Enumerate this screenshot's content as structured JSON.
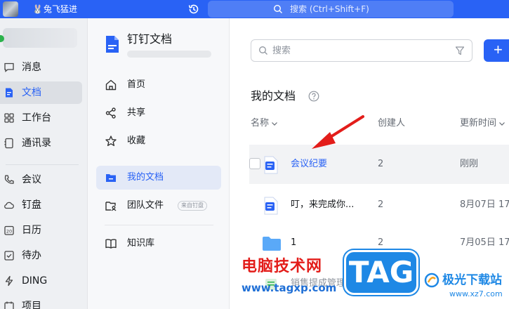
{
  "topbar": {
    "user_emoji": "🐰",
    "user_name": "兔飞猛进",
    "search_placeholder": "搜索 (Ctrl+Shift+F)"
  },
  "leftnav": {
    "items": [
      {
        "label": "消息",
        "icon": "message-icon"
      },
      {
        "label": "文档",
        "icon": "doc-icon",
        "active": true
      },
      {
        "label": "工作台",
        "icon": "grid-icon"
      },
      {
        "label": "通讯录",
        "icon": "contacts-icon"
      },
      {
        "label": "会议",
        "icon": "phone-icon"
      },
      {
        "label": "钉盘",
        "icon": "cloud-icon"
      },
      {
        "label": "日历",
        "icon": "calendar-icon"
      },
      {
        "label": "待办",
        "icon": "todo-icon"
      },
      {
        "label": "DING",
        "icon": "lightning-icon"
      },
      {
        "label": "项目",
        "icon": "project-icon"
      }
    ]
  },
  "docnav": {
    "app_title": "钉钉文档",
    "items": [
      {
        "label": "首页",
        "icon": "home-icon"
      },
      {
        "label": "共享",
        "icon": "share-icon"
      },
      {
        "label": "收藏",
        "icon": "star-icon"
      },
      {
        "label": "我的文档",
        "icon": "folder-icon",
        "active": true
      },
      {
        "label": "团队文件",
        "icon": "team-folder-icon",
        "badge": "来自钉盘"
      },
      {
        "label": "知识库",
        "icon": "book-icon"
      }
    ]
  },
  "main": {
    "search_placeholder": "搜索",
    "new_button_label": "+",
    "section_title": "我的文档",
    "columns": {
      "name": "名称",
      "creator": "创建人",
      "updated": "更新时间"
    },
    "rows": [
      {
        "name": "会议纪要",
        "creator": "2",
        "updated": "刚刚",
        "type": "doc"
      },
      {
        "name": "叮，来完成你...",
        "creator": "2",
        "updated": "8月07日 17",
        "type": "doc"
      },
      {
        "name": "1",
        "creator": "2",
        "updated": "7月05日 17",
        "type": "folder"
      },
      {
        "name": "销售提成管理表",
        "creator": "",
        "updated": "",
        "type": "sheet"
      }
    ]
  },
  "watermark": {
    "line1": "电脑技术网",
    "line2": "www.tagxp.com",
    "tag": "TAG",
    "brand": "极光下载站",
    "brand_url": "www.xz7.com"
  },
  "colors": {
    "accent": "#2962f5",
    "arrow": "#e31d1a"
  }
}
